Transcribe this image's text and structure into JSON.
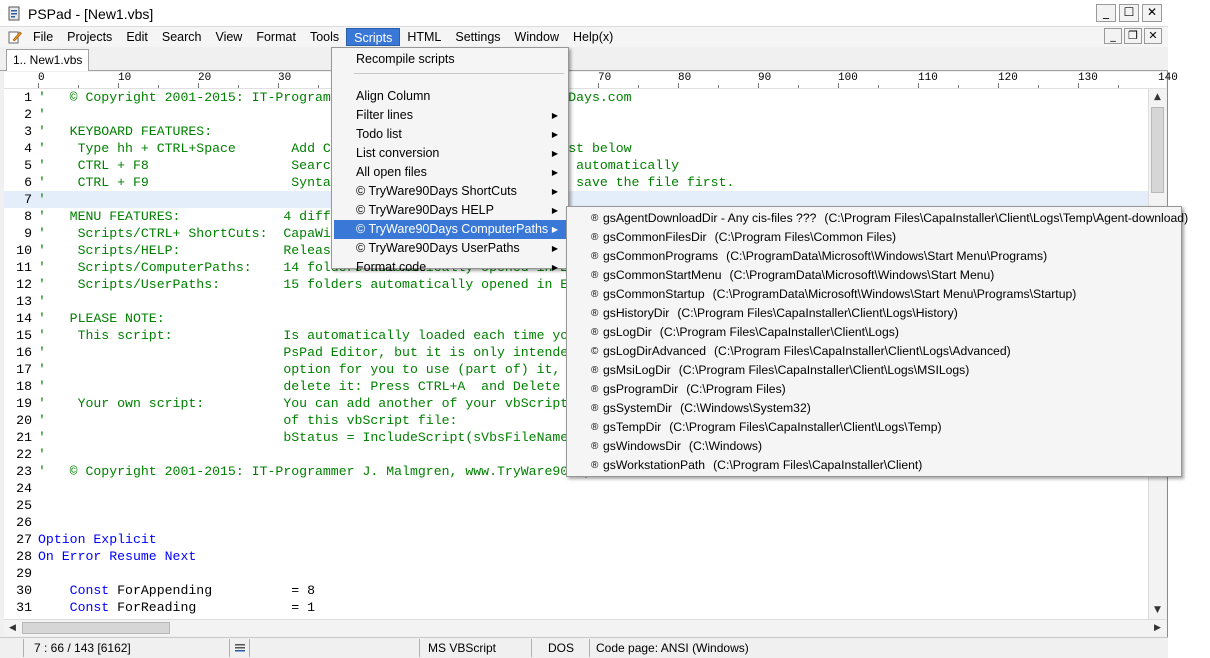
{
  "window": {
    "title": "PSPad - [New1.vbs]",
    "controls": {
      "minimize": "_",
      "maximize": "☐",
      "close": "✕"
    }
  },
  "menubar": {
    "items": [
      "File",
      "Projects",
      "Edit",
      "Search",
      "View",
      "Format",
      "Tools",
      "Scripts",
      "HTML",
      "Settings",
      "Window",
      "Help(x)"
    ],
    "active": "Scripts",
    "mdi_controls": {
      "minimize": "_",
      "restore": "❐",
      "close": "✕"
    }
  },
  "tabs": [
    {
      "label": "1.. New1.vbs",
      "active": true
    }
  ],
  "ruler": {
    "labels": [
      "0",
      "10",
      "20",
      "30",
      "40",
      "50",
      "60",
      "70",
      "80",
      "90",
      "100",
      "110",
      "120",
      "130",
      "140"
    ]
  },
  "editor": {
    "current_line": 7,
    "lines": [
      {
        "n": "1",
        "segments": [
          {
            "c": "comment",
            "t": "'   © Copyright 2001-2015: IT-Programmer J. Malmgren, www.TryWare90Days.com"
          }
        ]
      },
      {
        "n": "2",
        "segments": [
          {
            "c": "comment",
            "t": "'"
          }
        ]
      },
      {
        "n": "3",
        "segments": [
          {
            "c": "comment",
            "t": "'   KEYBOARD FEATURES:"
          }
        ]
      },
      {
        "n": "4",
        "segments": [
          {
            "c": "comment",
            "t": "'    Type hh + CTRL+Space       Add CapaWiki hyperlinks from the list below"
          }
        ]
      },
      {
        "n": "5",
        "segments": [
          {
            "c": "comment",
            "t": "'    CTRL + F8                  Search CapaWiki - it will be loaded automatically"
          }
        ]
      },
      {
        "n": "6",
        "segments": [
          {
            "c": "comment",
            "t": "'    CTRL + F9                  Syntax check of the file - you must save the file first."
          }
        ]
      },
      {
        "n": "7",
        "segments": [
          {
            "c": "comment",
            "t": "'"
          }
        ]
      },
      {
        "n": "8",
        "segments": [
          {
            "c": "comment",
            "t": "'   MENU FEATURES:             4 different menus"
          }
        ]
      },
      {
        "n": "9",
        "segments": [
          {
            "c": "comment",
            "t": "'    Scripts/CTRL+ ShortCuts:  CapaWiki shortcuts"
          }
        ]
      },
      {
        "n": "10",
        "segments": [
          {
            "c": "comment",
            "t": "'    Scripts/HELP:             Release notes and help"
          }
        ]
      },
      {
        "n": "11",
        "segments": [
          {
            "c": "comment",
            "t": "'    Scripts/ComputerPaths:    14 folders automatically opened in Explorer"
          }
        ]
      },
      {
        "n": "12",
        "segments": [
          {
            "c": "comment",
            "t": "'    Scripts/UserPaths:        15 folders automatically opened in Explorer"
          }
        ]
      },
      {
        "n": "13",
        "segments": [
          {
            "c": "comment",
            "t": "'"
          }
        ]
      },
      {
        "n": "14",
        "segments": [
          {
            "c": "comment",
            "t": "'   PLEASE NOTE:"
          }
        ]
      },
      {
        "n": "15",
        "segments": [
          {
            "c": "comment",
            "t": "'    This script:              Is automatically loaded each time you start"
          }
        ]
      },
      {
        "n": "16",
        "segments": [
          {
            "c": "comment",
            "t": "'                              PsPad Editor, but it is only intended as an"
          }
        ]
      },
      {
        "n": "17",
        "segments": [
          {
            "c": "comment",
            "t": "'                              option for you to use (part of) it, else just"
          }
        ]
      },
      {
        "n": "18",
        "segments": [
          {
            "c": "comment",
            "t": "'                              delete it: Press CTRL+A  and Delete"
          }
        ]
      },
      {
        "n": "19",
        "segments": [
          {
            "c": "comment",
            "t": "'    Your own script:          You can add another of your vbScripts in the top"
          }
        ]
      },
      {
        "n": "20",
        "segments": [
          {
            "c": "comment",
            "t": "'                              of this vbScript file:"
          }
        ]
      },
      {
        "n": "21",
        "segments": [
          {
            "c": "comment",
            "t": "'                              bStatus = IncludeScript(sVbsFileName)"
          }
        ]
      },
      {
        "n": "22",
        "segments": [
          {
            "c": "comment",
            "t": "'"
          }
        ]
      },
      {
        "n": "23",
        "segments": [
          {
            "c": "comment",
            "t": "'   © Copyright 2001-2015: IT-Programmer J. Malmgren, www.TryWare90Days.com"
          }
        ]
      },
      {
        "n": "24",
        "segments": []
      },
      {
        "n": "25",
        "segments": []
      },
      {
        "n": "26",
        "segments": []
      },
      {
        "n": "27",
        "segments": [
          {
            "c": "keyword",
            "t": "Option Explicit"
          }
        ]
      },
      {
        "n": "28",
        "segments": [
          {
            "c": "keyword",
            "t": "On Error Resume Next"
          }
        ]
      },
      {
        "n": "29",
        "segments": []
      },
      {
        "n": "30",
        "segments": [
          {
            "c": "plain",
            "t": "    "
          },
          {
            "c": "keyword",
            "t": "Const"
          },
          {
            "c": "plain",
            "t": " ForAppending          = 8"
          }
        ]
      },
      {
        "n": "31",
        "segments": [
          {
            "c": "plain",
            "t": "    "
          },
          {
            "c": "keyword",
            "t": "Const"
          },
          {
            "c": "plain",
            "t": " ForReading            = 1"
          }
        ]
      }
    ]
  },
  "statusbar": {
    "position": "7 : 66 / 143  [6162]",
    "syntax": "MS VBScript",
    "line_endings": "DOS",
    "codepage": "Code page: ANSI (Windows)"
  },
  "scripts_menu": {
    "items": [
      {
        "label": "Recompile scripts",
        "submenu": false
      },
      {
        "label": "Align Column",
        "submenu": false
      },
      {
        "label": "Filter lines",
        "submenu": true
      },
      {
        "label": "Todo list",
        "submenu": true
      },
      {
        "label": "List conversion",
        "submenu": true
      },
      {
        "label": "All open files",
        "submenu": true
      },
      {
        "label": "© TryWare90Days ShortCuts",
        "submenu": true
      },
      {
        "label": "© TryWare90Days HELP",
        "submenu": true
      },
      {
        "label": "© TryWare90Days ComputerPaths",
        "submenu": true,
        "highlighted": true
      },
      {
        "label": "© TryWare90Days UserPaths",
        "submenu": true
      },
      {
        "label": "Format code",
        "submenu": true
      }
    ]
  },
  "computerpaths_submenu": {
    "items": [
      {
        "icon": "®",
        "label": "gsAgentDownloadDir - Any cis-files ???",
        "path": "(C:\\Program Files\\CapaInstaller\\Client\\Logs\\Temp\\Agent-download)"
      },
      {
        "icon": "®",
        "label": "gsCommonFilesDir",
        "path": "(C:\\Program Files\\Common Files)"
      },
      {
        "icon": "®",
        "label": "gsCommonPrograms",
        "path": "(C:\\ProgramData\\Microsoft\\Windows\\Start Menu\\Programs)"
      },
      {
        "icon": "®",
        "label": "gsCommonStartMenu",
        "path": "(C:\\ProgramData\\Microsoft\\Windows\\Start Menu)"
      },
      {
        "icon": "®",
        "label": "gsCommonStartup",
        "path": "(C:\\ProgramData\\Microsoft\\Windows\\Start Menu\\Programs\\Startup)"
      },
      {
        "icon": "®",
        "label": "gsHistoryDir",
        "path": "(C:\\Program Files\\CapaInstaller\\Client\\Logs\\History)"
      },
      {
        "icon": "®",
        "label": "gsLogDir",
        "path": "(C:\\Program Files\\CapaInstaller\\Client\\Logs)"
      },
      {
        "icon": "©",
        "label": "gsLogDirAdvanced",
        "path": "(C:\\Program Files\\CapaInstaller\\Client\\Logs\\Advanced)"
      },
      {
        "icon": "®",
        "label": "gsMsiLogDir",
        "path": "(C:\\Program Files\\CapaInstaller\\Client\\Logs\\MSILogs)"
      },
      {
        "icon": "®",
        "label": "gsProgramDir",
        "path": "(C:\\Program Files)"
      },
      {
        "icon": "®",
        "label": "gsSystemDir",
        "path": "(C:\\Windows\\System32)"
      },
      {
        "icon": "®",
        "label": "gsTempDir",
        "path": "(C:\\Program Files\\CapaInstaller\\Client\\Logs\\Temp)"
      },
      {
        "icon": "®",
        "label": "gsWindowsDir",
        "path": "(C:\\Windows)"
      },
      {
        "icon": "®",
        "label": "gsWorkstationPath",
        "path": "(C:\\Program Files\\CapaInstaller\\Client)"
      }
    ]
  },
  "colors": {
    "comment": "#008000",
    "keyword": "#0000ff",
    "highlight": "#3a78d7",
    "current_line": "#e4eefa"
  }
}
